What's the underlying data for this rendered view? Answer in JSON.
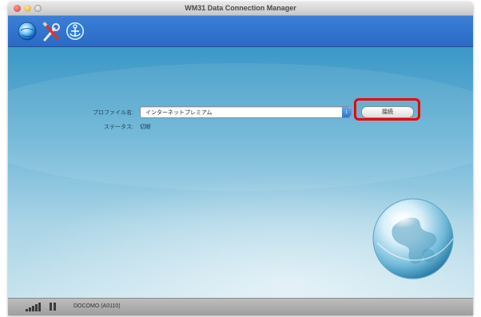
{
  "window": {
    "title": "WM31 Data Connection Manager"
  },
  "toolbar": {
    "icons": [
      "globe-connect-icon",
      "tools-settings-icon",
      "anchor-icon"
    ]
  },
  "profile": {
    "label": "プロファイル名:",
    "selected": "インターネットプレミアム"
  },
  "status": {
    "label": "ステータス:",
    "value": "切断"
  },
  "connect_button": {
    "label": "接続"
  },
  "statusbar": {
    "device": "DOCOMO (A0110)"
  },
  "colors": {
    "toolbar": "#2f72cc",
    "content_top": "#3c98c5",
    "content_bottom": "#c7e3ee",
    "highlight": "#f00000"
  }
}
